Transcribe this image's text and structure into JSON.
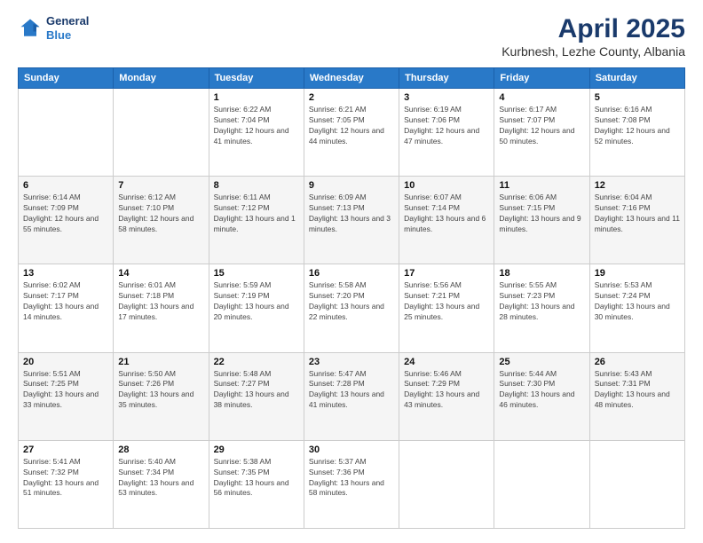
{
  "logo": {
    "line1": "General",
    "line2": "Blue"
  },
  "header": {
    "title": "April 2025",
    "subtitle": "Kurbnesh, Lezhe County, Albania"
  },
  "days": [
    "Sunday",
    "Monday",
    "Tuesday",
    "Wednesday",
    "Thursday",
    "Friday",
    "Saturday"
  ],
  "weeks": [
    [
      {
        "date": "",
        "info": ""
      },
      {
        "date": "",
        "info": ""
      },
      {
        "date": "1",
        "info": "Sunrise: 6:22 AM\nSunset: 7:04 PM\nDaylight: 12 hours and 41 minutes."
      },
      {
        "date": "2",
        "info": "Sunrise: 6:21 AM\nSunset: 7:05 PM\nDaylight: 12 hours and 44 minutes."
      },
      {
        "date": "3",
        "info": "Sunrise: 6:19 AM\nSunset: 7:06 PM\nDaylight: 12 hours and 47 minutes."
      },
      {
        "date": "4",
        "info": "Sunrise: 6:17 AM\nSunset: 7:07 PM\nDaylight: 12 hours and 50 minutes."
      },
      {
        "date": "5",
        "info": "Sunrise: 6:16 AM\nSunset: 7:08 PM\nDaylight: 12 hours and 52 minutes."
      }
    ],
    [
      {
        "date": "6",
        "info": "Sunrise: 6:14 AM\nSunset: 7:09 PM\nDaylight: 12 hours and 55 minutes."
      },
      {
        "date": "7",
        "info": "Sunrise: 6:12 AM\nSunset: 7:10 PM\nDaylight: 12 hours and 58 minutes."
      },
      {
        "date": "8",
        "info": "Sunrise: 6:11 AM\nSunset: 7:12 PM\nDaylight: 13 hours and 1 minute."
      },
      {
        "date": "9",
        "info": "Sunrise: 6:09 AM\nSunset: 7:13 PM\nDaylight: 13 hours and 3 minutes."
      },
      {
        "date": "10",
        "info": "Sunrise: 6:07 AM\nSunset: 7:14 PM\nDaylight: 13 hours and 6 minutes."
      },
      {
        "date": "11",
        "info": "Sunrise: 6:06 AM\nSunset: 7:15 PM\nDaylight: 13 hours and 9 minutes."
      },
      {
        "date": "12",
        "info": "Sunrise: 6:04 AM\nSunset: 7:16 PM\nDaylight: 13 hours and 11 minutes."
      }
    ],
    [
      {
        "date": "13",
        "info": "Sunrise: 6:02 AM\nSunset: 7:17 PM\nDaylight: 13 hours and 14 minutes."
      },
      {
        "date": "14",
        "info": "Sunrise: 6:01 AM\nSunset: 7:18 PM\nDaylight: 13 hours and 17 minutes."
      },
      {
        "date": "15",
        "info": "Sunrise: 5:59 AM\nSunset: 7:19 PM\nDaylight: 13 hours and 20 minutes."
      },
      {
        "date": "16",
        "info": "Sunrise: 5:58 AM\nSunset: 7:20 PM\nDaylight: 13 hours and 22 minutes."
      },
      {
        "date": "17",
        "info": "Sunrise: 5:56 AM\nSunset: 7:21 PM\nDaylight: 13 hours and 25 minutes."
      },
      {
        "date": "18",
        "info": "Sunrise: 5:55 AM\nSunset: 7:23 PM\nDaylight: 13 hours and 28 minutes."
      },
      {
        "date": "19",
        "info": "Sunrise: 5:53 AM\nSunset: 7:24 PM\nDaylight: 13 hours and 30 minutes."
      }
    ],
    [
      {
        "date": "20",
        "info": "Sunrise: 5:51 AM\nSunset: 7:25 PM\nDaylight: 13 hours and 33 minutes."
      },
      {
        "date": "21",
        "info": "Sunrise: 5:50 AM\nSunset: 7:26 PM\nDaylight: 13 hours and 35 minutes."
      },
      {
        "date": "22",
        "info": "Sunrise: 5:48 AM\nSunset: 7:27 PM\nDaylight: 13 hours and 38 minutes."
      },
      {
        "date": "23",
        "info": "Sunrise: 5:47 AM\nSunset: 7:28 PM\nDaylight: 13 hours and 41 minutes."
      },
      {
        "date": "24",
        "info": "Sunrise: 5:46 AM\nSunset: 7:29 PM\nDaylight: 13 hours and 43 minutes."
      },
      {
        "date": "25",
        "info": "Sunrise: 5:44 AM\nSunset: 7:30 PM\nDaylight: 13 hours and 46 minutes."
      },
      {
        "date": "26",
        "info": "Sunrise: 5:43 AM\nSunset: 7:31 PM\nDaylight: 13 hours and 48 minutes."
      }
    ],
    [
      {
        "date": "27",
        "info": "Sunrise: 5:41 AM\nSunset: 7:32 PM\nDaylight: 13 hours and 51 minutes."
      },
      {
        "date": "28",
        "info": "Sunrise: 5:40 AM\nSunset: 7:34 PM\nDaylight: 13 hours and 53 minutes."
      },
      {
        "date": "29",
        "info": "Sunrise: 5:38 AM\nSunset: 7:35 PM\nDaylight: 13 hours and 56 minutes."
      },
      {
        "date": "30",
        "info": "Sunrise: 5:37 AM\nSunset: 7:36 PM\nDaylight: 13 hours and 58 minutes."
      },
      {
        "date": "",
        "info": ""
      },
      {
        "date": "",
        "info": ""
      },
      {
        "date": "",
        "info": ""
      }
    ]
  ]
}
